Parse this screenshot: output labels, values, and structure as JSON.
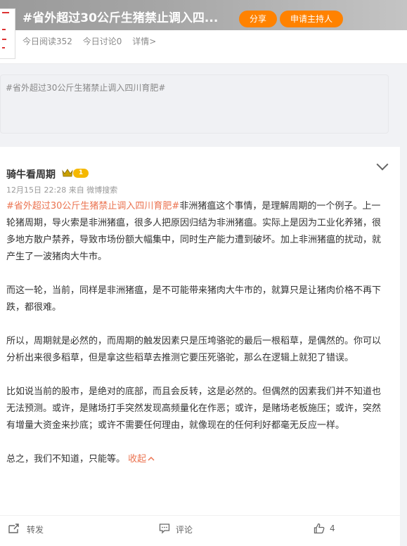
{
  "topic": {
    "title": "#省外超过30公斤生猪禁止调入四...",
    "share_label": "分享",
    "host_label": "申请主持人",
    "reads": "今日阅读352",
    "discussions": "今日讨论0",
    "details": "详情>"
  },
  "composer": {
    "text": "#省外超过30公斤生猪禁止调入四川育肥#"
  },
  "post": {
    "author": "骑牛看周期",
    "vip_badge": "1",
    "timestamp": "12月15日 22:28",
    "source": "来自 微博搜索",
    "hashtag": "#省外超过30公斤生猪禁止调入四川育肥#",
    "para1_rest": "非洲猪瘟这个事情，是理解周期的一个例子。上一轮猪周期，导火索是非洲猪瘟，很多人把原因归结为非洲猪瘟。实际上是因为工业化养猪，很多地方散户禁养，导致市场份额大幅集中，同时生产能力遭到破坏。加上非洲猪瘟的扰动，就产生了一波猪肉大牛市。",
    "para2": "而这一轮，当前，同样是非洲猪瘟，是不可能带来猪肉大牛市的，就算只是让猪肉价格不再下跌，都很难。",
    "para3": "所以，周期就是必然的，而周期的触发因素只是压垮骆驼的最后一根稻草，是偶然的。你可以分析出来很多稻草，但是拿这些稻草去推测它要压死骆驼，那么在逻辑上就犯了错误。",
    "para4": "比如说当前的股市，是绝对的底部，而且会反转，这是必然的。但偶然的因素我们并不知道也无法预测。或许，是赌场打手突然发现高频量化在作恶；或许，是赌场老板施压；或许，突然有增量大资金来抄底；或许不需要任何理由，就像现在的任何利好都毫无反应一样。",
    "para5": "总之，我们不知道，只能等。",
    "collapse_label": "收起",
    "repost_label": "转发",
    "comment_label": "评论",
    "like_count": "4"
  },
  "colors": {
    "accent": "#ff8200",
    "link": "#eb7350"
  }
}
